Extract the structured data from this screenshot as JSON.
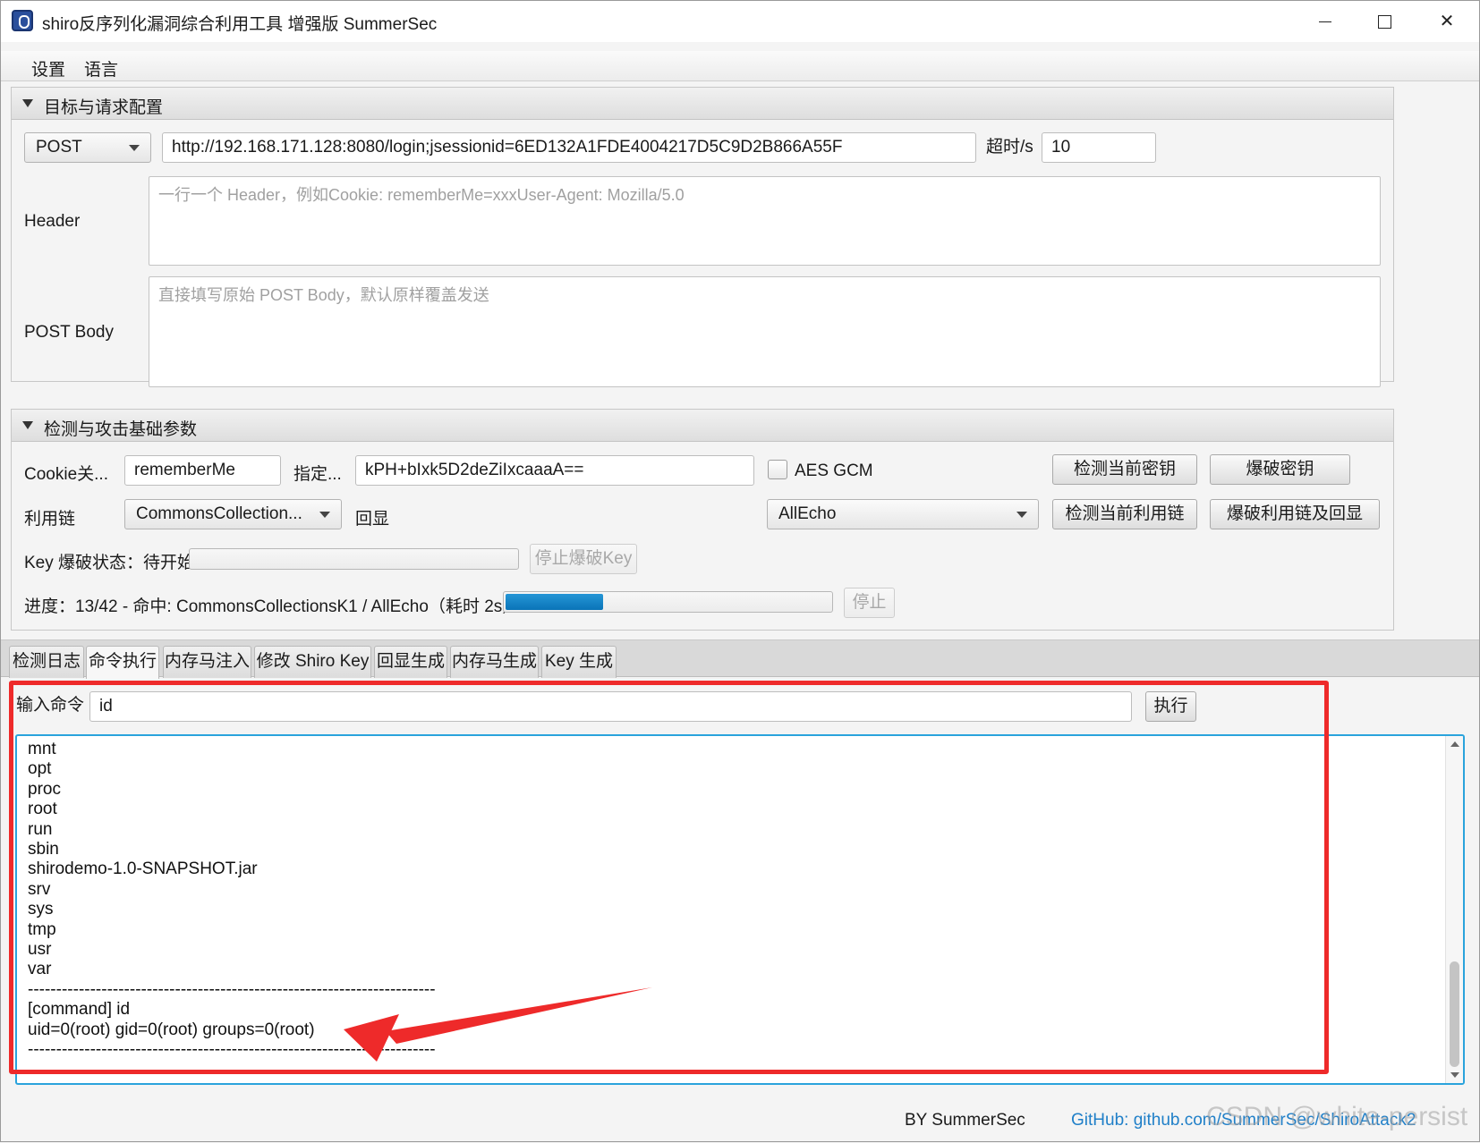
{
  "window": {
    "title": "shiro反序列化漏洞综合利用工具 增强版 SummerSec"
  },
  "menu": {
    "settings": "设置",
    "language": "语言"
  },
  "target_panel": {
    "title": "目标与请求配置",
    "method": "POST",
    "url": "http://192.168.171.128:8080/login;jsessionid=6ED132A1FDE4004217D5C9D2B866A55F",
    "timeout_label": "超时/s",
    "timeout_value": "10",
    "header_label": "Header",
    "header_placeholder": "一行一个 Header，例如Cookie: rememberMe=xxxUser-Agent: Mozilla/5.0",
    "body_label": "POST Body",
    "body_placeholder": "直接填写原始 POST Body，默认原样覆盖发送"
  },
  "attack_panel": {
    "title": "检测与攻击基础参数",
    "cookie_label": "Cookie关...",
    "cookie_value": "rememberMe",
    "key_label": "指定...",
    "key_value": "kPH+bIxk5D2deZiIxcaaaA==",
    "aes_gcm_label": "AES GCM",
    "aes_gcm_checked": false,
    "detect_key_button": "检测当前密钥",
    "brute_key_button": "爆破密钥",
    "chain_label": "利用链",
    "chain_value": "CommonsCollection...",
    "echo_label": "回显",
    "echo_value": "AllEcho",
    "detect_chain_button": "检测当前利用链",
    "brute_chain_button": "爆破利用链及回显",
    "key_brute_status": "Key 爆破状态：待开始",
    "stop_key_button": "停止爆破Key",
    "progress_text": "进度：13/42 - 命中: CommonsCollectionsK1 / AllEcho（耗时 2s）",
    "progress_fraction": 0.3,
    "stop_button": "停止"
  },
  "tabs": [
    "检测日志",
    "命令执行",
    "内存马注入",
    "修改 Shiro Key",
    "回显生成",
    "内存马生成",
    "Key 生成"
  ],
  "active_tab": "命令执行",
  "command": {
    "label": "输入命令",
    "value": "id",
    "execute_button": "执行"
  },
  "output_lines": [
    "mnt",
    "opt",
    "proc",
    "root",
    "run",
    "sbin",
    "shirodemo-1.0-SNAPSHOT.jar",
    "srv",
    "sys",
    "tmp",
    "usr",
    "var",
    "------------------------------------------------------------------------",
    "[command] id",
    "uid=0(root) gid=0(root) groups=0(root)",
    "------------------------------------------------------------------------"
  ],
  "footer": {
    "by": "BY SummerSec",
    "github": "GitHub: github.com/SummerSec/ShiroAttack2",
    "watermark": "CSDN @white-persist"
  },
  "colors": {
    "accent": "#2aa3dc",
    "progress": "#0a74b8",
    "annotation": "#ee2a2a",
    "link": "#1f7fc8"
  }
}
